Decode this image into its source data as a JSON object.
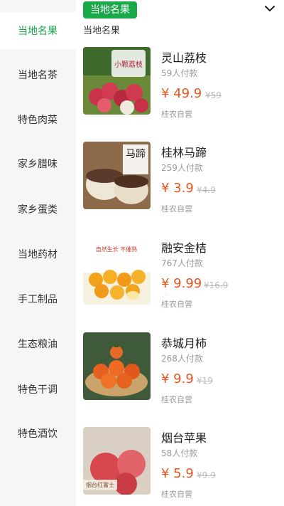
{
  "sidebar": {
    "items": [
      {
        "label": "当地名果",
        "active": true
      },
      {
        "label": "当地名茶"
      },
      {
        "label": "特色肉菜"
      },
      {
        "label": "家乡腊味"
      },
      {
        "label": "家乡蛋类"
      },
      {
        "label": "当地药材"
      },
      {
        "label": "手工制品"
      },
      {
        "label": "生态粮油"
      },
      {
        "label": "特色干调"
      },
      {
        "label": "特色酒饮"
      }
    ]
  },
  "header": {
    "tab_label": "当地名果",
    "section_title": "当地名果",
    "accent_color": "#19a84a"
  },
  "products": [
    {
      "name": "灵山荔枝",
      "sold": "59人付款",
      "price": "¥ 49.9",
      "original": "¥59",
      "shop": "桂农自营",
      "image_text": "小颗荔枝",
      "image": "lychee"
    },
    {
      "name": "桂林马蹄",
      "sold": "259人付款",
      "price": "¥ 3.9",
      "original": "¥4.9",
      "shop": "桂农自营",
      "image_text": "马蹄",
      "image": "water-chestnut"
    },
    {
      "name": "融安金桔",
      "sold": "767人付款",
      "price": "¥ 9.99",
      "original": "¥16.9",
      "shop": "桂农自营",
      "image_text": "自然生长 不催熟",
      "image": "kumquat"
    },
    {
      "name": "恭城月柿",
      "sold": "268人付款",
      "price": "¥ 9.9",
      "original": "¥19",
      "shop": "桂农自营",
      "image": "persimmon"
    },
    {
      "name": "烟台苹果",
      "sold": "58人付款",
      "price": "¥ 5.9",
      "original": "¥9.9",
      "shop": "桂农自营",
      "image_text": "烟台红富士",
      "image": "apple"
    }
  ],
  "colors": {
    "price": "#e8541e",
    "muted": "#999999"
  }
}
